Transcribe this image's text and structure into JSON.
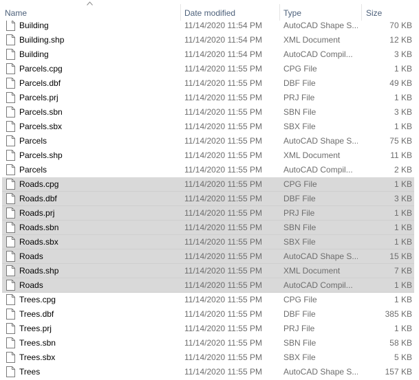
{
  "columns": {
    "name": "Name",
    "date": "Date modified",
    "type": "Type",
    "size": "Size"
  },
  "icons": {
    "sort": "chevron-up-icon",
    "file": "file-icon"
  },
  "colors": {
    "selection": "#d9d9d9",
    "header_text": "#4c607a"
  },
  "files": [
    {
      "name": "Building",
      "date": "11/14/2020 11:54 PM",
      "type": "AutoCAD Shape S...",
      "size": "70 KB",
      "selected": false
    },
    {
      "name": "Building.shp",
      "date": "11/14/2020 11:54 PM",
      "type": "XML Document",
      "size": "12 KB",
      "selected": false
    },
    {
      "name": "Building",
      "date": "11/14/2020 11:54 PM",
      "type": "AutoCAD Compil...",
      "size": "3 KB",
      "selected": false
    },
    {
      "name": "Parcels.cpg",
      "date": "11/14/2020 11:55 PM",
      "type": "CPG File",
      "size": "1 KB",
      "selected": false
    },
    {
      "name": "Parcels.dbf",
      "date": "11/14/2020 11:55 PM",
      "type": "DBF File",
      "size": "49 KB",
      "selected": false
    },
    {
      "name": "Parcels.prj",
      "date": "11/14/2020 11:55 PM",
      "type": "PRJ File",
      "size": "1 KB",
      "selected": false
    },
    {
      "name": "Parcels.sbn",
      "date": "11/14/2020 11:55 PM",
      "type": "SBN File",
      "size": "3 KB",
      "selected": false
    },
    {
      "name": "Parcels.sbx",
      "date": "11/14/2020 11:55 PM",
      "type": "SBX File",
      "size": "1 KB",
      "selected": false
    },
    {
      "name": "Parcels",
      "date": "11/14/2020 11:55 PM",
      "type": "AutoCAD Shape S...",
      "size": "75 KB",
      "selected": false
    },
    {
      "name": "Parcels.shp",
      "date": "11/14/2020 11:55 PM",
      "type": "XML Document",
      "size": "11 KB",
      "selected": false
    },
    {
      "name": "Parcels",
      "date": "11/14/2020 11:55 PM",
      "type": "AutoCAD Compil...",
      "size": "2 KB",
      "selected": false
    },
    {
      "name": "Roads.cpg",
      "date": "11/14/2020 11:55 PM",
      "type": "CPG File",
      "size": "1 KB",
      "selected": true
    },
    {
      "name": "Roads.dbf",
      "date": "11/14/2020 11:55 PM",
      "type": "DBF File",
      "size": "3 KB",
      "selected": true
    },
    {
      "name": "Roads.prj",
      "date": "11/14/2020 11:55 PM",
      "type": "PRJ File",
      "size": "1 KB",
      "selected": true
    },
    {
      "name": "Roads.sbn",
      "date": "11/14/2020 11:55 PM",
      "type": "SBN File",
      "size": "1 KB",
      "selected": true
    },
    {
      "name": "Roads.sbx",
      "date": "11/14/2020 11:55 PM",
      "type": "SBX File",
      "size": "1 KB",
      "selected": true
    },
    {
      "name": "Roads",
      "date": "11/14/2020 11:55 PM",
      "type": "AutoCAD Shape S...",
      "size": "15 KB",
      "selected": true
    },
    {
      "name": "Roads.shp",
      "date": "11/14/2020 11:55 PM",
      "type": "XML Document",
      "size": "7 KB",
      "selected": true
    },
    {
      "name": "Roads",
      "date": "11/14/2020 11:55 PM",
      "type": "AutoCAD Compil...",
      "size": "1 KB",
      "selected": true
    },
    {
      "name": "Trees.cpg",
      "date": "11/14/2020 11:55 PM",
      "type": "CPG File",
      "size": "1 KB",
      "selected": false
    },
    {
      "name": "Trees.dbf",
      "date": "11/14/2020 11:55 PM",
      "type": "DBF File",
      "size": "385 KB",
      "selected": false
    },
    {
      "name": "Trees.prj",
      "date": "11/14/2020 11:55 PM",
      "type": "PRJ File",
      "size": "1 KB",
      "selected": false
    },
    {
      "name": "Trees.sbn",
      "date": "11/14/2020 11:55 PM",
      "type": "SBN File",
      "size": "58 KB",
      "selected": false
    },
    {
      "name": "Trees.sbx",
      "date": "11/14/2020 11:55 PM",
      "type": "SBX File",
      "size": "5 KB",
      "selected": false
    },
    {
      "name": "Trees",
      "date": "11/14/2020 11:55 PM",
      "type": "AutoCAD Shape S...",
      "size": "157 KB",
      "selected": false
    }
  ]
}
